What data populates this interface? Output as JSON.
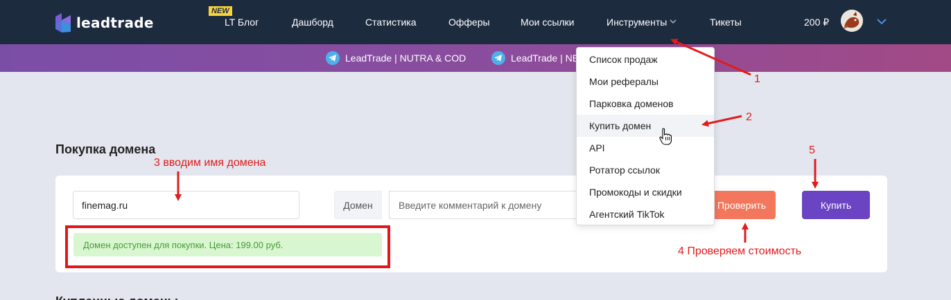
{
  "brand": {
    "name": "leadtrade"
  },
  "nav": {
    "new_badge": "NEW",
    "items": [
      "LT Блог",
      "Дашборд",
      "Статистика",
      "Офферы",
      "Мои ссылки",
      "Инструменты",
      "Тикеты"
    ],
    "balance": "200 ₽"
  },
  "banner": {
    "channels": [
      "LeadTrade | NUTRA & COD",
      "LeadTrade | NE"
    ]
  },
  "page": {
    "title": "Покупка домена",
    "bottom_title": "Купленные домены"
  },
  "form": {
    "domain_value": "finemag.ru",
    "domain_addon": "Домен",
    "comment_placeholder": "Введите комментарий к домену",
    "check_label": "Проверить",
    "buy_label": "Купить",
    "status_message": "Домен доступен для покупки. Цена: 199.00 руб."
  },
  "dropdown": {
    "items": [
      "Список продаж",
      "Мои рефералы",
      "Парковка доменов",
      "Купить домен",
      "API",
      "Ротатор ссылок",
      "Промокоды и скидки",
      "Агентский TikTok"
    ]
  },
  "annotations": {
    "step1": "1",
    "step2": "2",
    "step3": "3 вводим имя домена",
    "step4": "4 Проверяем стоимость",
    "step5": "5"
  },
  "colors": {
    "nav_bg": "#1d2b3f",
    "check_button": "#f3775c",
    "buy_button": "#6a44c2",
    "annotation_red": "#e21b1b",
    "success_bg": "#d8f6cf"
  }
}
